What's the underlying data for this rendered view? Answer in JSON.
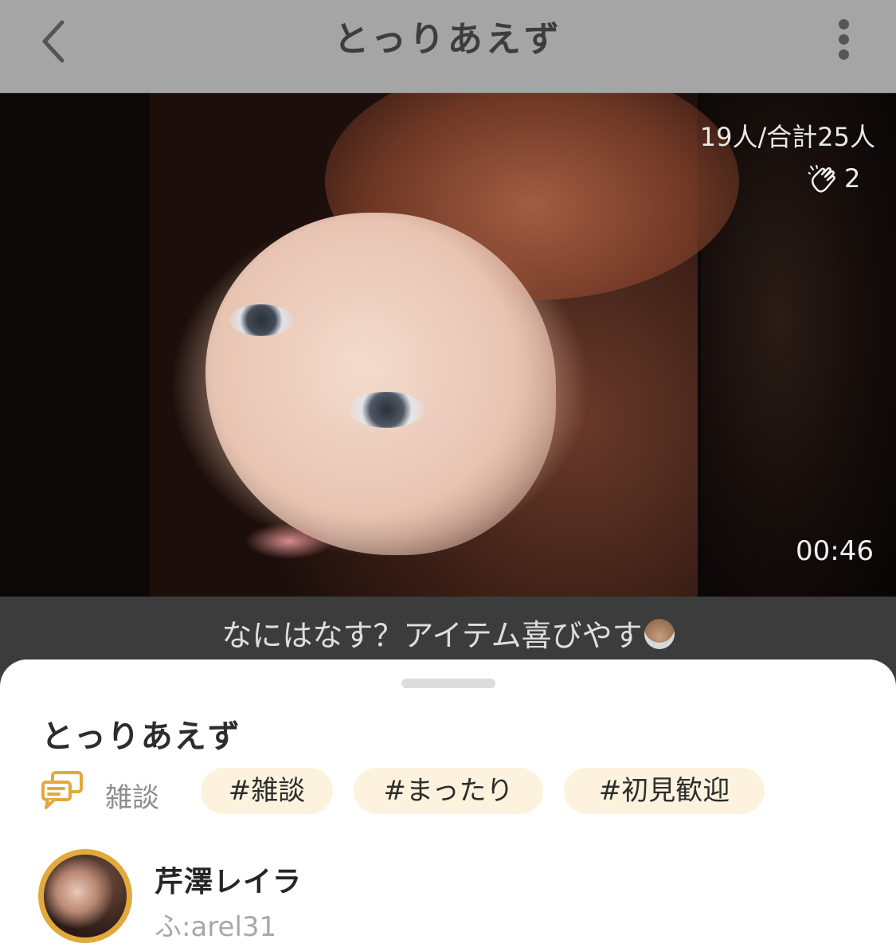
{
  "header": {
    "title": "とっりあえず",
    "back_icon": "chevron-left-icon",
    "menu_icon": "more-vertical-icon"
  },
  "video": {
    "viewers": "19人/合計25人",
    "clap_icon": "clapping-hands-icon",
    "clap_count": "2",
    "elapsed": "00:46"
  },
  "caption": {
    "text": "なにはなす？アイテム喜びやす",
    "emoji": "older-woman-emoji"
  },
  "sheet": {
    "room_name": "とっりあえず",
    "category_icon": "chat-bubbles-icon",
    "category": "雑談",
    "tags": [
      "#雑談",
      "#まったり",
      "#初見歓迎"
    ],
    "host": {
      "name": "芹澤レイラ",
      "handle": "ふ:arel31"
    }
  },
  "colors": {
    "header_bg": "#a5a5a5",
    "tag_bg": "#fdf2dd",
    "accent_gold": "#e2a93c",
    "caption_bg": "#3c3c3c"
  }
}
